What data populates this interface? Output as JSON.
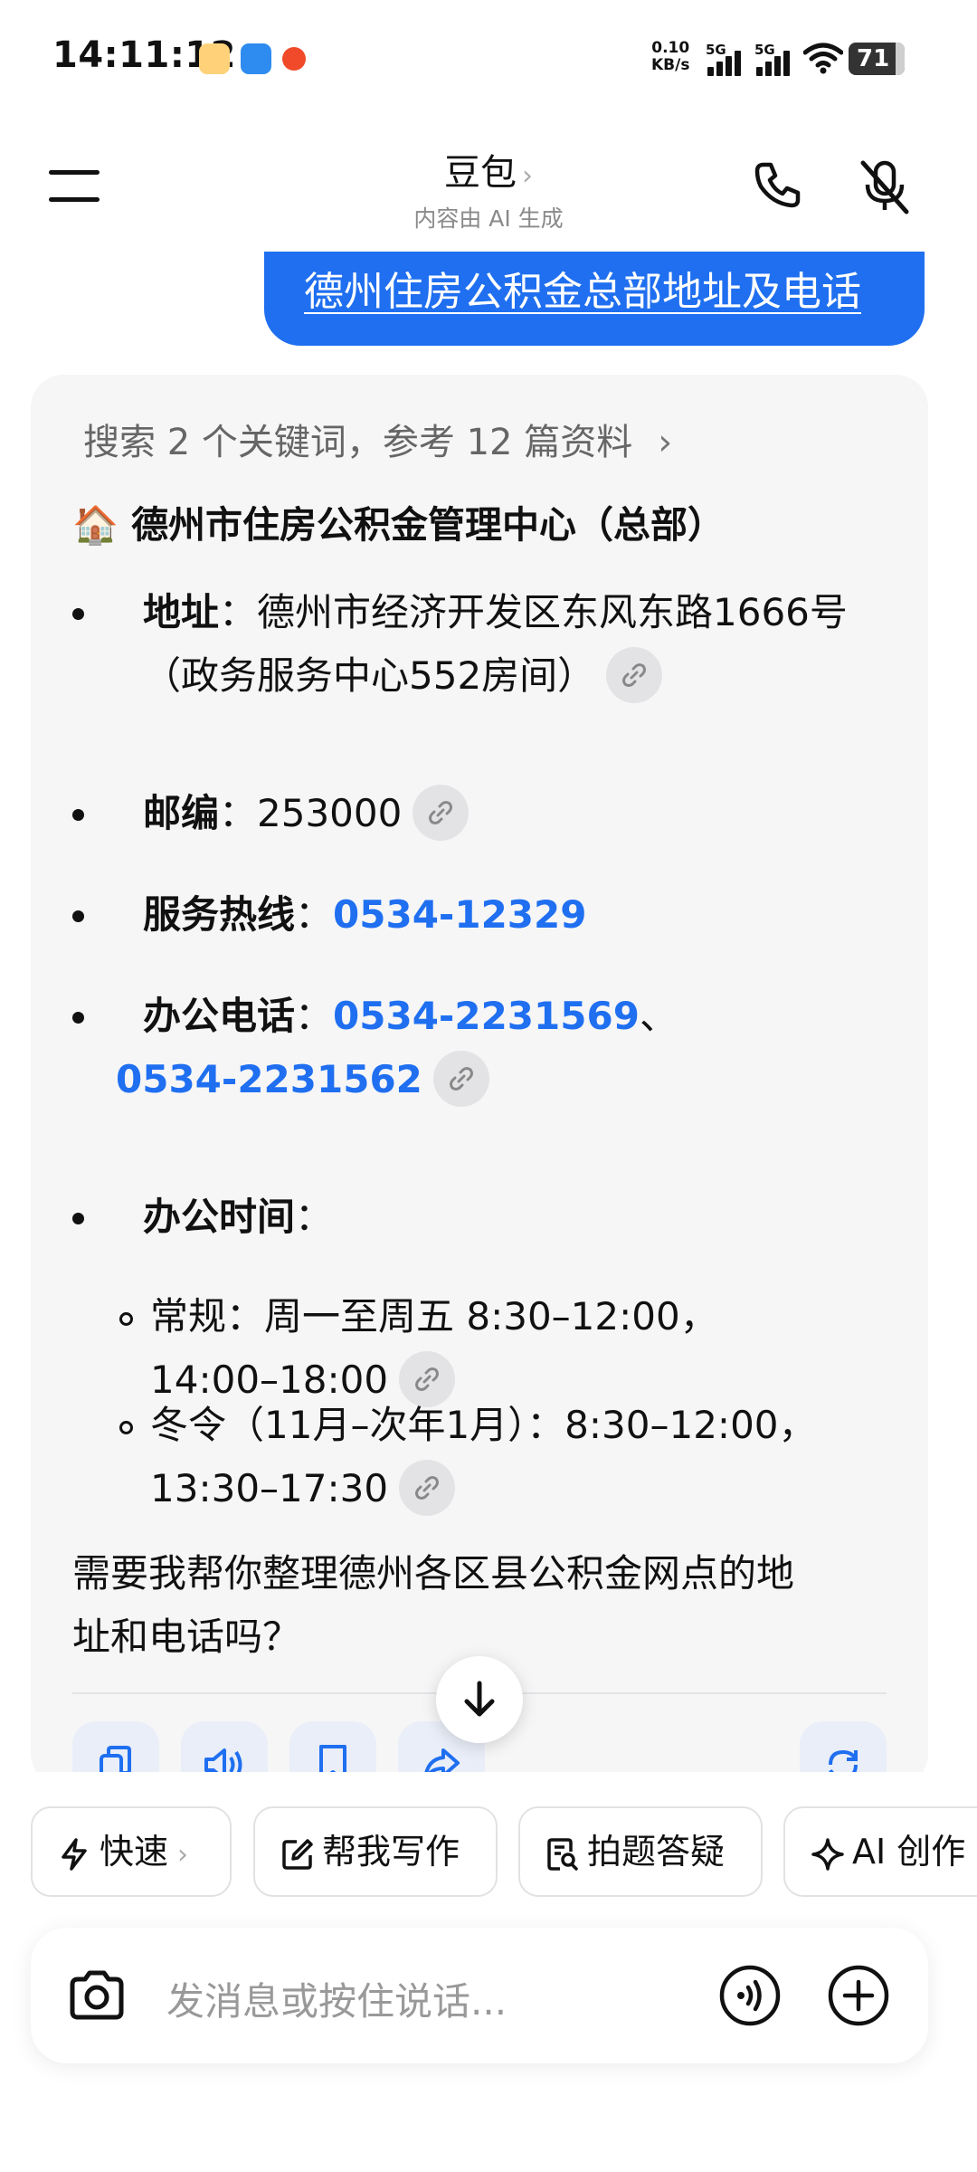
{
  "status_bar": {
    "time": "14:11:12",
    "net_speed_value": "0.10",
    "net_speed_unit": "KB/s",
    "sim1_label": "5G",
    "sim2_label": "5G",
    "battery": "71",
    "app_icons": [
      "assistant-app-icon",
      "settings-app-icon",
      "notification-app-icon"
    ]
  },
  "header": {
    "title": "豆包",
    "subtitle": "内容由 AI 生成",
    "menu_icon": "menu-icon",
    "call_icon": "phone-icon",
    "mute_icon": "mic-off-icon"
  },
  "user_message": "德州住房公积金总部地址及电话",
  "answer": {
    "search_summary": "搜索 2 个关键词，参考 12 篇资料",
    "heading_icon": "🏠",
    "heading": "德州市住房公积金管理中心（总部）",
    "address_label": "地址",
    "address_value_line1": "：德州市经济开发区东风东路1666号",
    "address_value_line2": "（政务服务中心552房间）",
    "postcode_label": "邮编",
    "postcode_value": "：253000",
    "hotline_label": "服务热线",
    "hotline_value": "0534-12329",
    "office_phone_label": "办公电话",
    "office_phone_1": "0534-2231569",
    "office_phone_sep": "、",
    "office_phone_2": "0534-2231562",
    "hours_label": "办公时间",
    "hours_regular_line1": "常规：周一至周五 8:30–12:00，",
    "hours_regular_line2": "14:00–18:00",
    "hours_winter_line1": "冬令（11月–次年1月）：8:30–12:00，",
    "hours_winter_line2": "13:30–17:30",
    "followup_line1": "需要我帮你整理德州各区县公积金网点的地",
    "followup_line2": "址和电话吗？"
  },
  "shortcuts": [
    {
      "label": "快速",
      "icon": "lightning-icon"
    },
    {
      "label": "帮我写作",
      "icon": "edit-icon"
    },
    {
      "label": "拍题答疑",
      "icon": "scan-doc-icon"
    },
    {
      "label": "AI 创作",
      "icon": "sparkle-icon"
    }
  ],
  "input": {
    "placeholder": "发消息或按住说话..."
  },
  "colors": {
    "accent": "#1f6ff0",
    "card_bg": "#f6f6f7"
  }
}
